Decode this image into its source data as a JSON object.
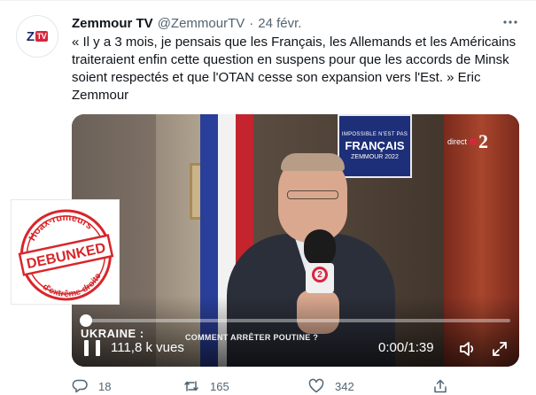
{
  "tweet": {
    "display_name": "Zemmour TV",
    "handle": "@ZemmourTV",
    "separator": "·",
    "date": "24 févr.",
    "text": "« Il y a 3 mois, je pensais que les Français, les Allemands et les Américains traiteraient enfin cette question en suspens pour que les accords de Minsk soient respectés et que l'OTAN cesse son expansion vers l'Est. » Eric Zemmour",
    "avatar": {
      "letter": "Z",
      "badge": "TV"
    },
    "more_icon": "more-dots-icon"
  },
  "video": {
    "channel_label": "direct",
    "channel_number": "2",
    "poster": {
      "line1": "IMPOSSIBLE N'EST PAS",
      "line2": "FRANÇAIS",
      "line3": "ZEMMOUR 2022"
    },
    "mic_logo": "2",
    "lower_third_title": "UKRAINE :",
    "lower_third_subtitle": "COMMENT ARRÊTER POUTINE ?",
    "views": "111,8 k vues",
    "time_current": "0:00",
    "time_separator": "/",
    "time_total": "1:39",
    "progress": 0,
    "icons": {
      "pause": "pause-icon",
      "sound": "speaker-icon",
      "fullscreen": "fullscreen-icon"
    }
  },
  "stamp": {
    "top_text": "Hoax-rumeurs",
    "middle_text": "DEBUNKED",
    "bottom_text": "d'extrême-droite",
    "color": "#d8262b"
  },
  "actions": {
    "reply_count": "18",
    "retweet_count": "165",
    "like_count": "342",
    "icons": {
      "reply": "reply-icon",
      "retweet": "retweet-icon",
      "like": "heart-icon",
      "share": "share-icon"
    }
  },
  "colors": {
    "text_primary": "#0f1419",
    "text_secondary": "#536471",
    "brand_red": "#d7263d"
  }
}
